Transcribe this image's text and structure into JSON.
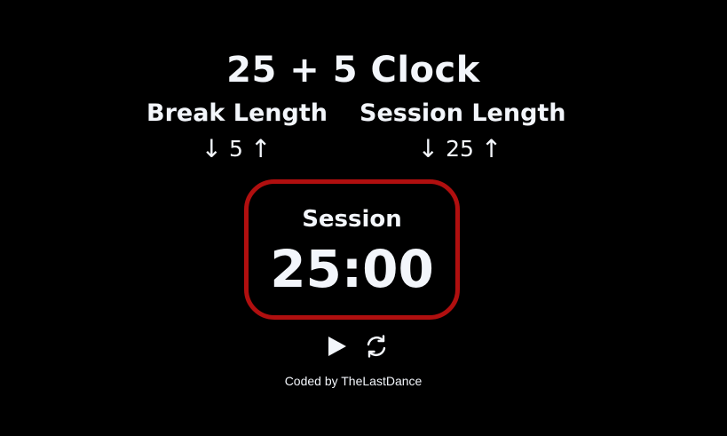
{
  "app": {
    "title": "25 + 5 Clock",
    "footer": "Coded by TheLastDance"
  },
  "break": {
    "label": "Break Length",
    "decrement": "↓",
    "value": "5",
    "increment": "↑"
  },
  "session": {
    "label": "Session Length",
    "decrement": "↓",
    "value": "25",
    "increment": "↑"
  },
  "timer": {
    "label": "Session",
    "time_left": "25:00",
    "border_color": "#b00f0f"
  },
  "controls": {
    "start_icon": "play-icon",
    "reset_icon": "refresh-icon"
  }
}
